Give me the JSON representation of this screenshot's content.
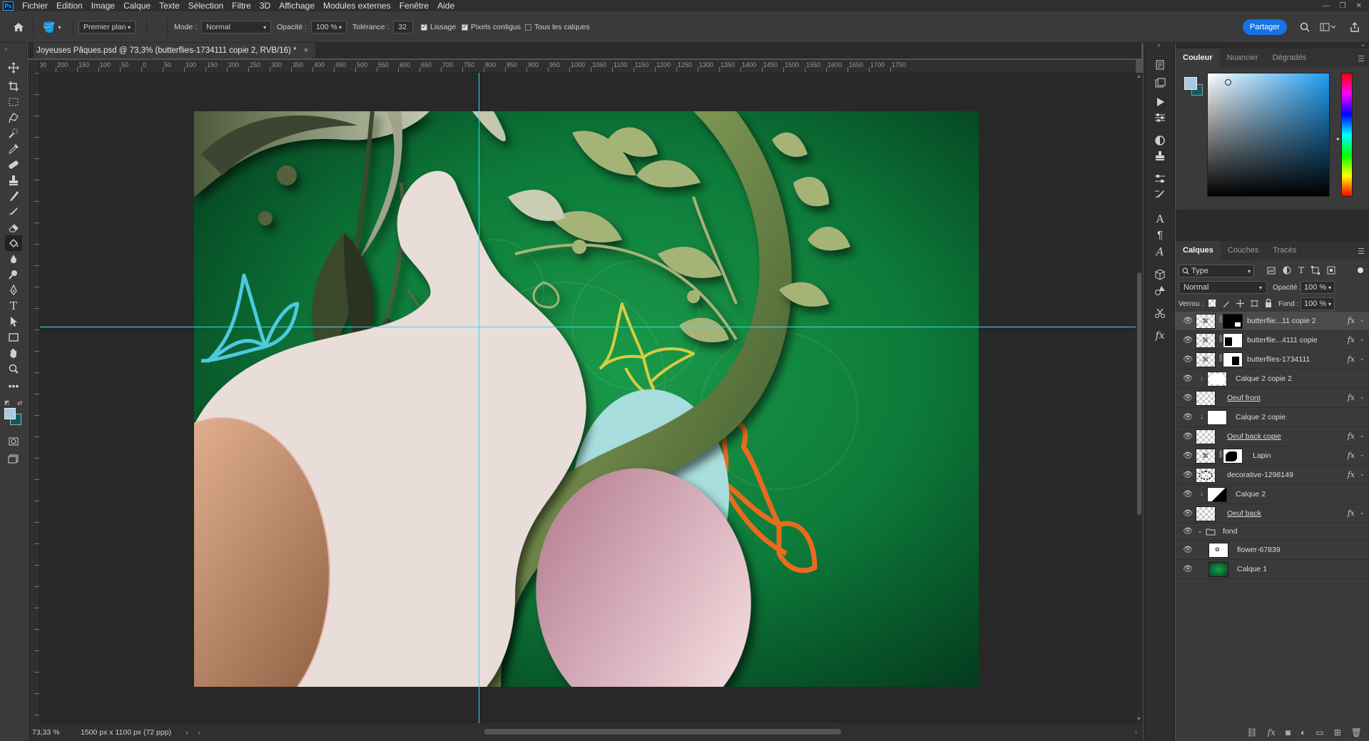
{
  "menu": {
    "logo": "Ps",
    "items": [
      "Fichier",
      "Edition",
      "Image",
      "Calque",
      "Texte",
      "Sélection",
      "Filtre",
      "3D",
      "Affichage",
      "Modules externes",
      "Fenêtre",
      "Aide"
    ]
  },
  "options": {
    "fill_source": "Premier plan",
    "mode_label": "Mode :",
    "mode_value": "Normal",
    "opacity_label": "Opacité :",
    "opacity_value": "100 %",
    "tolerance_label": "Tolérance :",
    "tolerance_value": "32",
    "smoothing_label": "Lissage",
    "contiguous_label": "Pixels contigus",
    "all_layers_label": "Tous les calques",
    "share_label": "Partager"
  },
  "document": {
    "tab_title": "Joyeuses Pâques.psd @ 73,3% (butterflies-1734111 copie 2, RVB/16) *",
    "close": "×"
  },
  "ruler_top_labels": [
    "100",
    "200",
    "150",
    "100",
    "50",
    "0",
    "50",
    "100",
    "150",
    "200",
    "250",
    "300",
    "350",
    "400",
    "450",
    "500",
    "550",
    "600",
    "650",
    "700",
    "750",
    "800",
    "850",
    "900",
    "950",
    "1000",
    "1050",
    "1100",
    "1150",
    "1200",
    "1250",
    "1300",
    "1350",
    "1400",
    "1450",
    "1500",
    "1550",
    "1600",
    "1650",
    "1700",
    "1750"
  ],
  "status": {
    "zoom": "73,33 %",
    "doc_size": "1500 px x 1100 px (72 ppp)"
  },
  "color_panel": {
    "tabs": [
      "Couleur",
      "Nuancier",
      "Dégradés"
    ],
    "foreground": "#a7c9e4",
    "background": "#0c5c63"
  },
  "layers_panel": {
    "tabs": [
      "Calques",
      "Couches",
      "Tracés"
    ],
    "filter_kind": "Type",
    "blend_mode": "Normal",
    "opacity_label": "Opacité :",
    "opacity_value": "100 %",
    "lock_label": "Verrou :",
    "fill_label": "Fond :",
    "fill_value": "100 %",
    "layers": [
      {
        "name": "butterflie...11 copie 2",
        "fx": "fx",
        "selected": true
      },
      {
        "name": "butterflie...4111 copie",
        "fx": "fx"
      },
      {
        "name": "butterflies-1734111",
        "fx": "fx"
      },
      {
        "name": "Calque 2 copie 2",
        "fx": ""
      },
      {
        "name": "Oeuf front",
        "fx": "fx"
      },
      {
        "name": "Calque 2 copie",
        "fx": ""
      },
      {
        "name": "Oeuf back copie",
        "fx": "fx"
      },
      {
        "name": "Lapin",
        "fx": "fx"
      },
      {
        "name": "decorative-1298149",
        "fx": "fx"
      },
      {
        "name": "Calque 2",
        "fx": ""
      },
      {
        "name": "Oeuf back",
        "fx": "fx"
      },
      {
        "name": "fond",
        "fx": ""
      },
      {
        "name": "flower-67839",
        "fx": ""
      },
      {
        "name": "Calque 1",
        "fx": ""
      }
    ]
  }
}
